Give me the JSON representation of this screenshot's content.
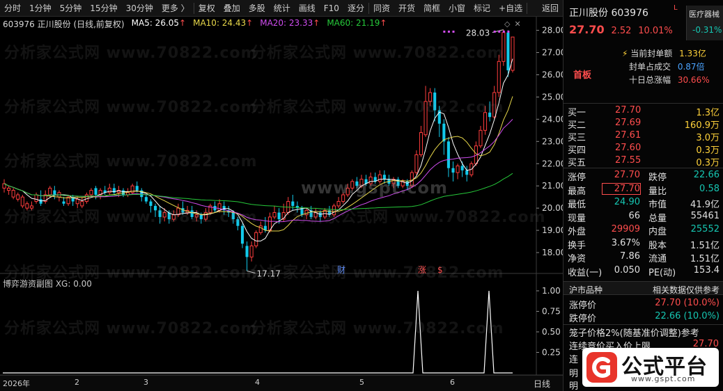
{
  "toolbar": {
    "items": [
      "分时",
      "1分钟",
      "5分钟",
      "15分钟",
      "30分钟",
      "更多 〉",
      "复权",
      "叠加",
      "多股",
      "统计",
      "画线",
      "F10",
      "逐分",
      "同资",
      "开货",
      "简框",
      "小窗",
      "标记",
      "+自选"
    ],
    "return_label": "返回"
  },
  "main_chart": {
    "legend": {
      "title": "603976 正川股份 (日线,前复权)",
      "ma5": "MA5: 26.05",
      "ma10": "MA10: 24.43",
      "ma20": "MA20: 23.33",
      "ma60": "MA60: 21.19",
      "arrow": "↑"
    },
    "colors": {
      "up": "#ff3d3d",
      "down": "#12c9ea",
      "ma5": "#ffffff",
      "ma10": "#e8d84a",
      "ma20": "#d04cf0",
      "ma60": "#26c93a",
      "high_label": "#e0e0e0"
    },
    "y_ticks": [
      "28.00",
      "27.00",
      "26.00",
      "25.00",
      "24.00",
      "23.00",
      "22.00",
      "21.00",
      "20.00",
      "19.00",
      "18.00"
    ],
    "high_label": "28.03",
    "low_label": "17.17",
    "markers": [
      {
        "text": "财",
        "color": "#5b8cff"
      },
      {
        "text": "涨",
        "color": "#ff4d4d"
      },
      {
        "text": "$",
        "color": "#ff4d4d"
      }
    ],
    "watermark": "分析家公式网 www.70822.com",
    "center_watermark": "www.gspt.com"
  },
  "sub_chart": {
    "legend": "博弈游资副图 XG: 0.00",
    "y_ticks": [
      "1.00",
      "0.75",
      "0.50",
      "0.25"
    ],
    "signal_values": [
      0,
      0,
      1,
      0,
      0,
      1,
      0,
      0
    ],
    "signal_color": "#ffffff"
  },
  "date_axis": {
    "labels": [
      "2026年",
      "2",
      "3",
      "4",
      "5",
      "6"
    ],
    "period": "日线"
  },
  "chart_data": {
    "type": "candlestick",
    "title": "603976 正川股份 (日线,前复权)",
    "ylim": [
      17.5,
      28.3
    ],
    "ma": {
      "MA5": 26.05,
      "MA10": 24.43,
      "MA20": 23.33,
      "MA60": 21.19
    },
    "high": 28.03,
    "low": 17.17,
    "candles": [
      [
        20.9,
        21.1,
        21.3,
        20.7
      ],
      [
        20.8,
        20.9,
        21.0,
        20.6
      ],
      [
        20.5,
        20.8,
        20.9,
        20.4
      ],
      [
        20.4,
        20.6,
        20.7,
        20.3
      ],
      [
        20.1,
        20.5,
        20.6,
        20.0
      ],
      [
        20.0,
        20.2,
        20.3,
        19.9
      ],
      [
        20.0,
        20.1,
        20.3,
        19.9
      ],
      [
        20.3,
        20.6,
        20.7,
        20.2
      ],
      [
        20.4,
        20.2,
        20.8,
        20.1
      ],
      [
        20.3,
        20.6,
        20.8,
        20.2
      ],
      [
        20.6,
        20.9,
        21.0,
        20.5
      ],
      [
        20.8,
        20.6,
        21.0,
        20.4
      ],
      [
        20.5,
        20.7,
        20.8,
        20.3
      ],
      [
        20.3,
        20.2,
        20.5,
        20.1
      ],
      [
        20.2,
        20.5,
        20.6,
        20.1
      ],
      [
        20.5,
        20.3,
        20.6,
        20.1
      ],
      [
        20.2,
        20.4,
        20.5,
        20.0
      ],
      [
        20.1,
        20.3,
        20.5,
        20.0
      ],
      [
        20.3,
        20.6,
        20.7,
        20.2
      ],
      [
        20.6,
        20.8,
        20.9,
        20.5
      ],
      [
        20.9,
        20.6,
        21.0,
        20.4
      ],
      [
        20.6,
        20.8,
        20.9,
        20.4
      ],
      [
        20.8,
        20.7,
        21.0,
        20.6
      ],
      [
        20.7,
        20.9,
        21.1,
        20.6
      ],
      [
        20.9,
        20.7,
        21.1,
        20.6
      ],
      [
        20.7,
        20.8,
        21.0,
        20.5
      ],
      [
        20.8,
        20.6,
        20.9,
        20.5
      ],
      [
        20.6,
        20.7,
        20.9,
        20.5
      ],
      [
        20.7,
        21.0,
        21.1,
        20.6
      ],
      [
        21.0,
        20.8,
        21.2,
        20.7
      ],
      [
        20.8,
        20.5,
        20.9,
        20.3
      ],
      [
        20.5,
        20.3,
        20.6,
        20.2
      ],
      [
        20.3,
        20.1,
        20.4,
        19.8
      ],
      [
        20.1,
        19.9,
        20.2,
        19.6
      ],
      [
        19.9,
        19.6,
        20.1,
        19.3
      ],
      [
        19.6,
        19.8,
        20.0,
        19.4
      ],
      [
        19.8,
        19.5,
        19.9,
        19.3
      ],
      [
        19.5,
        19.7,
        19.9,
        19.4
      ],
      [
        19.7,
        20.0,
        20.2,
        19.6
      ],
      [
        20.0,
        19.8,
        20.3,
        19.7
      ],
      [
        19.8,
        19.9,
        20.1,
        19.7
      ],
      [
        19.9,
        19.6,
        20.1,
        19.5
      ],
      [
        19.6,
        19.7,
        19.9,
        19.4
      ],
      [
        19.7,
        19.5,
        19.8,
        19.3
      ],
      [
        19.5,
        19.8,
        20.0,
        19.4
      ],
      [
        19.8,
        20.1,
        20.2,
        19.7
      ],
      [
        20.1,
        19.9,
        20.3,
        19.8
      ],
      [
        19.9,
        20.2,
        20.4,
        19.8
      ],
      [
        20.1,
        19.9,
        20.3,
        19.7
      ],
      [
        19.9,
        19.8,
        20.1,
        19.6
      ],
      [
        19.8,
        19.5,
        19.9,
        19.3
      ],
      [
        19.5,
        19.2,
        19.6,
        19.0
      ],
      [
        19.2,
        18.4,
        19.3,
        18.2
      ],
      [
        18.3,
        17.8,
        18.5,
        17.17
      ],
      [
        17.8,
        18.3,
        18.5,
        17.6
      ],
      [
        18.3,
        18.9,
        19.0,
        18.2
      ],
      [
        18.9,
        19.2,
        19.4,
        18.8
      ],
      [
        19.2,
        19.0,
        19.6,
        18.9
      ],
      [
        19.0,
        19.6,
        19.8,
        18.9
      ],
      [
        19.6,
        19.8,
        20.1,
        19.5
      ],
      [
        19.8,
        19.5,
        20.0,
        19.3
      ],
      [
        19.5,
        19.8,
        20.2,
        19.4
      ],
      [
        19.8,
        20.3,
        20.5,
        19.7
      ],
      [
        20.3,
        20.1,
        20.6,
        19.9
      ],
      [
        20.1,
        20.0,
        20.3,
        19.8
      ],
      [
        20.0,
        19.7,
        20.1,
        19.6
      ],
      [
        19.7,
        19.9,
        20.0,
        19.5
      ],
      [
        19.9,
        19.6,
        20.1,
        19.5
      ],
      [
        19.6,
        19.8,
        20.0,
        19.5
      ],
      [
        19.8,
        19.6,
        19.9,
        19.4
      ],
      [
        19.6,
        19.9,
        20.0,
        19.5
      ],
      [
        19.9,
        19.7,
        20.1,
        19.6
      ],
      [
        19.7,
        20.1,
        20.2,
        19.6
      ],
      [
        20.1,
        20.3,
        20.5,
        20.0
      ],
      [
        20.3,
        20.6,
        20.7,
        20.2
      ],
      [
        20.6,
        20.9,
        21.1,
        20.5
      ],
      [
        20.9,
        21.2,
        21.3,
        20.8
      ],
      [
        21.2,
        21.0,
        21.4,
        20.9
      ],
      [
        21.0,
        21.3,
        21.5,
        20.9
      ],
      [
        21.3,
        21.1,
        21.5,
        21.0
      ],
      [
        21.1,
        21.4,
        21.6,
        21.0
      ],
      [
        21.4,
        21.2,
        21.6,
        21.1
      ],
      [
        21.2,
        21.5,
        21.7,
        21.1
      ],
      [
        21.5,
        21.3,
        21.7,
        21.1
      ],
      [
        21.3,
        21.1,
        21.5,
        21.0
      ],
      [
        21.1,
        21.3,
        21.4,
        20.9
      ],
      [
        21.3,
        21.0,
        21.4,
        20.9
      ],
      [
        21.0,
        21.2,
        21.3,
        20.9
      ],
      [
        21.2,
        21.0,
        21.3,
        20.8
      ],
      [
        21.0,
        21.6,
        21.7,
        20.9
      ],
      [
        21.6,
        22.4,
        22.6,
        21.5
      ],
      [
        22.4,
        23.4,
        23.7,
        22.3
      ],
      [
        23.3,
        24.8,
        25.5,
        23.2
      ],
      [
        24.8,
        25.2,
        25.4,
        24.6
      ],
      [
        25.2,
        24.4,
        25.4,
        23.9
      ],
      [
        24.4,
        23.8,
        24.6,
        23.2
      ],
      [
        23.8,
        23.0,
        24.0,
        22.4
      ],
      [
        23.0,
        21.8,
        23.2,
        21.4
      ],
      [
        21.8,
        21.6,
        22.1,
        21.2
      ],
      [
        21.6,
        21.9,
        22.0,
        21.3
      ],
      [
        21.9,
        21.7,
        22.1,
        21.4
      ],
      [
        21.7,
        21.5,
        21.9,
        21.2
      ],
      [
        21.5,
        22.0,
        22.1,
        21.4
      ],
      [
        22.0,
        22.8,
        23.0,
        21.9
      ],
      [
        22.8,
        23.5,
        23.7,
        22.7
      ],
      [
        23.5,
        24.3,
        24.6,
        23.3
      ],
      [
        24.3,
        24.1,
        24.8,
        23.9
      ],
      [
        24.1,
        25.2,
        25.5,
        24.0
      ],
      [
        25.2,
        26.6,
        26.9,
        25.0
      ],
      [
        26.6,
        27.9,
        28.03,
        26.4
      ],
      [
        27.9,
        26.2,
        28.0,
        25.9
      ],
      [
        26.2,
        27.7,
        27.7,
        26.1
      ]
    ]
  },
  "panel": {
    "title": "正川股份 603976",
    "title_mark": "L",
    "sector_name": "医疗器械",
    "sector_pct": "-0.31%",
    "price": "27.70",
    "change": "2.52",
    "change_pct": "10.01%",
    "seal": {
      "l1": "当前封单额",
      "v1": "1.33亿",
      "l2": "封单占成交",
      "v2": "0.87倍",
      "l3": "十日总涨幅",
      "v3": "30.66%",
      "tag": "首板",
      "bolt": "⚡"
    },
    "book": [
      {
        "label": "买一",
        "price": "27.70",
        "vol": "1.3亿"
      },
      {
        "label": "买二",
        "price": "27.69",
        "vol": "160.9万"
      },
      {
        "label": "买三",
        "price": "27.61",
        "vol": "3.0万"
      },
      {
        "label": "买四",
        "price": "27.60",
        "vol": "0.3万"
      },
      {
        "label": "买五",
        "price": "27.55",
        "vol": "0.3万"
      }
    ],
    "quote": [
      {
        "l1": "涨停",
        "v1": "27.70",
        "c1": "red",
        "l2": "跌停",
        "v2": "22.66",
        "c2": "grn"
      },
      {
        "l1": "最高",
        "v1": "27.70",
        "c1": "red",
        "b1": true,
        "l2": "量比",
        "v2": "0.58",
        "c2": "grn"
      },
      {
        "l1": "最低",
        "v1": "24.90",
        "c1": "grn",
        "l2": "市值",
        "v2": "41.9亿",
        "c2": "wht"
      },
      {
        "l1": "现量",
        "v1": "66",
        "c1": "wht",
        "l2": "总量",
        "v2": "55461",
        "c2": "wht"
      },
      {
        "l1": "外盘",
        "v1": "29909",
        "c1": "red",
        "l2": "内盘",
        "v2": "25552",
        "c2": "grn"
      },
      {
        "l1": "换手",
        "v1": "3.67%",
        "c1": "wht",
        "l2": "股本",
        "v2": "1.51亿",
        "c2": "wht"
      },
      {
        "l1": "净资",
        "v1": "7.86",
        "c1": "wht",
        "l2": "流通",
        "v2": "1.51亿",
        "c2": "wht"
      },
      {
        "l1": "收益(一)",
        "v1": "0.050",
        "c1": "wht",
        "l2": "PE(动)",
        "v2": "153.4",
        "c2": "wht"
      }
    ],
    "market_label": "沪市品种",
    "market_note": "相关数据仅供参考",
    "limit_up_label": "涨停价",
    "limit_up_value": "27.70 (10.0%)",
    "limit_down_label": "跌停价",
    "limit_down_value": "22.66 (10.0%)",
    "cage_note": "笼子价格2%(随基准价调整)参考",
    "auction_label": "连续竞价买入价上限",
    "auction_value": "27.70",
    "trail_a": "连",
    "trail_b": "明",
    "trail_c": "明"
  },
  "brand": {
    "name": "公式平台",
    "url": "www.gspt.com"
  }
}
